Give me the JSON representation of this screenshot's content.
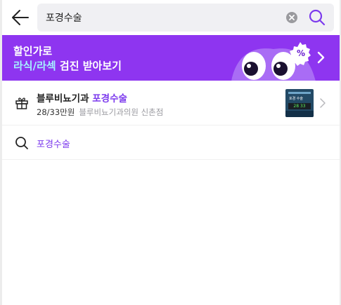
{
  "search": {
    "query": "포경수술"
  },
  "banner": {
    "line1": "할인가로",
    "line2_highlight": "라식/라섹",
    "line2_rest": " 검진 받아보기",
    "badge": "%",
    "color": "#8e35f0",
    "highlight_color": "#a5f0ff"
  },
  "product": {
    "title_prefix": "블루비뇨기과 ",
    "title_highlight": "포경수술",
    "price": "28/33만원",
    "clinic": "블루비뇨기과의원 신촌점",
    "thumbnail": {
      "label": "포경 수술",
      "prices": "28 33"
    }
  },
  "suggestion": {
    "text": "포경수술"
  },
  "colors": {
    "accent": "#7c3aed"
  },
  "icons": {
    "back": "arrow-left-icon",
    "clear": "clear-icon",
    "search": "search-icon",
    "gift": "gift-icon",
    "chevron": "chevron-right-icon",
    "suggestion": "search-icon"
  }
}
